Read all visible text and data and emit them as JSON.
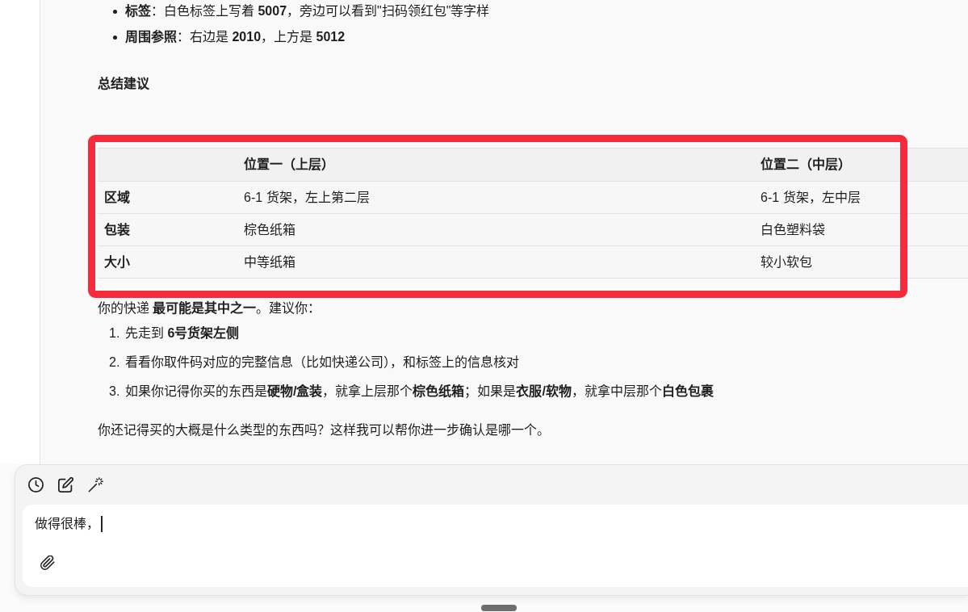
{
  "message": {
    "bullets": [
      {
        "text": "**标签**：白色标签上写着 **5007**，旁边可以看到\"扫码领红包\"等字样"
      },
      {
        "text": "**周围参照**：右边是 **2010**，上方是 **5012**"
      }
    ],
    "heading": "总结建议",
    "table": {
      "columns": [
        "位置一（上层）",
        "位置二（中层）"
      ],
      "rows": [
        {
          "label": "区域",
          "cells": [
            "6-1 货架，左上第二层",
            "6-1 货架，左中层"
          ]
        },
        {
          "label": "包装",
          "cells": [
            "棕色纸箱",
            "白色塑料袋"
          ]
        },
        {
          "label": "大小",
          "cells": [
            "中等纸箱",
            "较小软包"
          ]
        }
      ]
    },
    "intro": "你的快递 **最可能是其中之一**。建议你：",
    "steps": [
      {
        "marker": "1.",
        "text": "先走到 **6号货架左侧**"
      },
      {
        "marker": "2.",
        "text": "看看你取件码对应的完整信息（比如快递公司），和标签上的信息核对"
      },
      {
        "marker": "3.",
        "text": "如果你记得你买的东西是**硬物/盒装**，就拿上层那个**棕色纸箱**；如果是**衣服/软物**，就拿中层那个**白色包裹**"
      }
    ],
    "closing": "你还记得买的大概是什么类型的东西吗？这样我可以帮你进一步确认是哪一个。"
  },
  "composer": {
    "value": "做得很棒，",
    "focused": true
  }
}
